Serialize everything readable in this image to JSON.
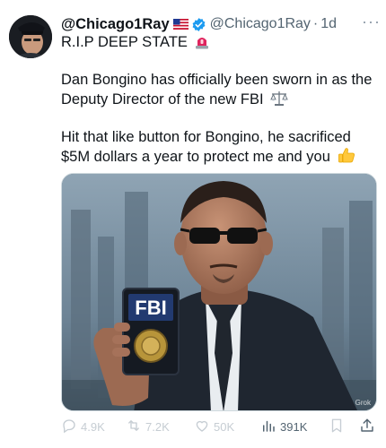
{
  "tweet": {
    "author": {
      "display_name": "@Chicago1Ray",
      "handle": "@Chicago1Ray",
      "timestamp": "1d",
      "dot": "·",
      "flag_icon": "us-flag-icon",
      "verified_icon": "verified-badge-icon",
      "verified_color": "#1d9bf0"
    },
    "more_label": "···",
    "headline": {
      "text": "R.I.P DEEP STATE",
      "icon": "siren-icon"
    },
    "body": {
      "line1": "Dan Bongino has officially been sworn in as the",
      "line2": "Deputy Director of the new FBI",
      "line2_icon": "scales-of-justice-icon",
      "line3": "Hit that like button for Bongino,  he sacrificed",
      "line4": "$5M dollars a year to protect me and you",
      "line4_icon": "thumbs-up-icon"
    },
    "media": {
      "badge_text": "FBI",
      "watermark": "Grok"
    },
    "actions": {
      "replies": "4.9K",
      "reposts": "7.2K",
      "likes": "50K",
      "views": "391K"
    }
  }
}
